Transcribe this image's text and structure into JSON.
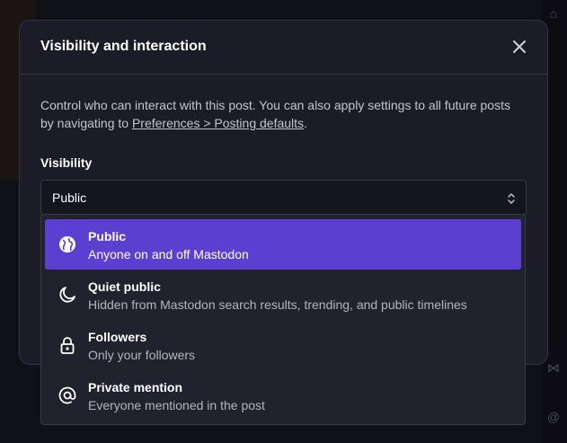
{
  "dialog": {
    "title": "Visibility and interaction",
    "close_label": "Close"
  },
  "description": {
    "text_before": "Control who can interact with this post. You can also apply settings to all future posts by navigating to ",
    "link_text": "Preferences > Posting defaults",
    "text_after": "."
  },
  "visibility": {
    "label": "Visibility",
    "selected_value": "Public"
  },
  "options": [
    {
      "title": "Public",
      "description": "Anyone on and off Mastodon",
      "icon": "globe-icon",
      "selected": true
    },
    {
      "title": "Quiet public",
      "description": "Hidden from Mastodon search results, trending, and public timelines",
      "icon": "moon-icon",
      "selected": false
    },
    {
      "title": "Followers",
      "description": "Only your followers",
      "icon": "lock-icon",
      "selected": false
    },
    {
      "title": "Private mention",
      "description": "Everyone mentioned in the post",
      "icon": "at-icon",
      "selected": false
    }
  ],
  "colors": {
    "accent": "#5b3fd1",
    "modal_bg": "#1c1c28",
    "dropdown_bg": "#22222e"
  }
}
